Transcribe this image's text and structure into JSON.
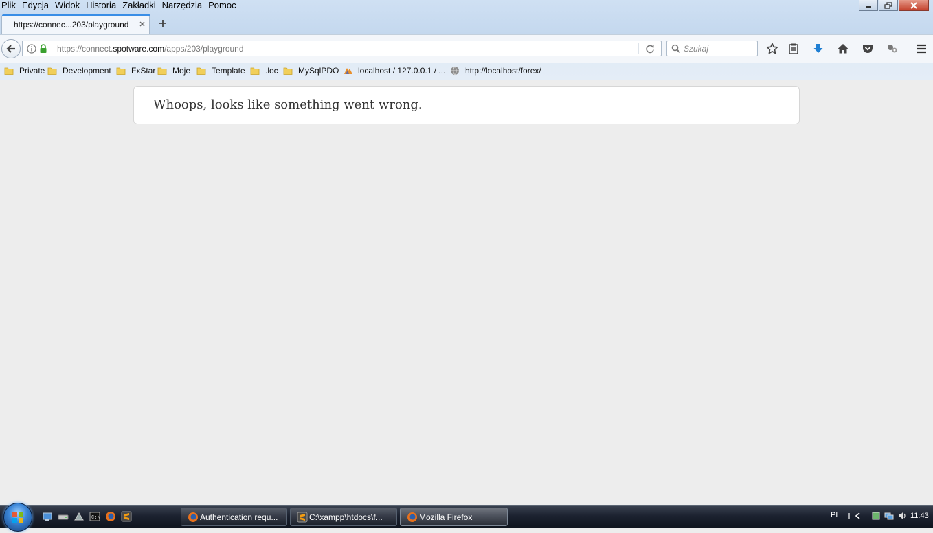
{
  "menu": [
    "Plik",
    "Edycja",
    "Widok",
    "Historia",
    "Zakładki",
    "Narzędzia",
    "Pomoc"
  ],
  "tab": {
    "title": "https://connec...203/playground"
  },
  "url": {
    "prefix": "https://connect.",
    "domain": "spotware.com",
    "path": "/apps/203/playground"
  },
  "search": {
    "placeholder": "Szukaj"
  },
  "bookmarks": [
    {
      "label": "Private",
      "icon": "folder-icon"
    },
    {
      "label": "Development",
      "icon": "folder-icon"
    },
    {
      "label": "FxStar",
      "icon": "folder-icon"
    },
    {
      "label": "Moje",
      "icon": "folder-icon"
    },
    {
      "label": "Template",
      "icon": "folder-icon"
    },
    {
      "label": ".loc",
      "icon": "folder-icon"
    },
    {
      "label": "MySqlPDO",
      "icon": "folder-icon"
    },
    {
      "label": "localhost / 127.0.0.1 / ...",
      "icon": "phpmyadmin-icon"
    },
    {
      "label": "http://localhost/forex/",
      "icon": "globe-icon"
    }
  ],
  "content": {
    "error_message": "Whoops, looks like something went wrong."
  },
  "taskbar": {
    "tasks": [
      {
        "label": "Authentication requ...",
        "icon": "firefox-icon"
      },
      {
        "label": "C:\\xampp\\htdocs\\f...",
        "icon": "sublime-icon"
      },
      {
        "label": "Mozilla Firefox",
        "icon": "firefox-icon"
      }
    ],
    "language": "PL",
    "clock": "11:43"
  },
  "colors": {
    "accent": "#3a8ee6",
    "taskbar": "#1c2230",
    "page_bg": "#ededed"
  }
}
